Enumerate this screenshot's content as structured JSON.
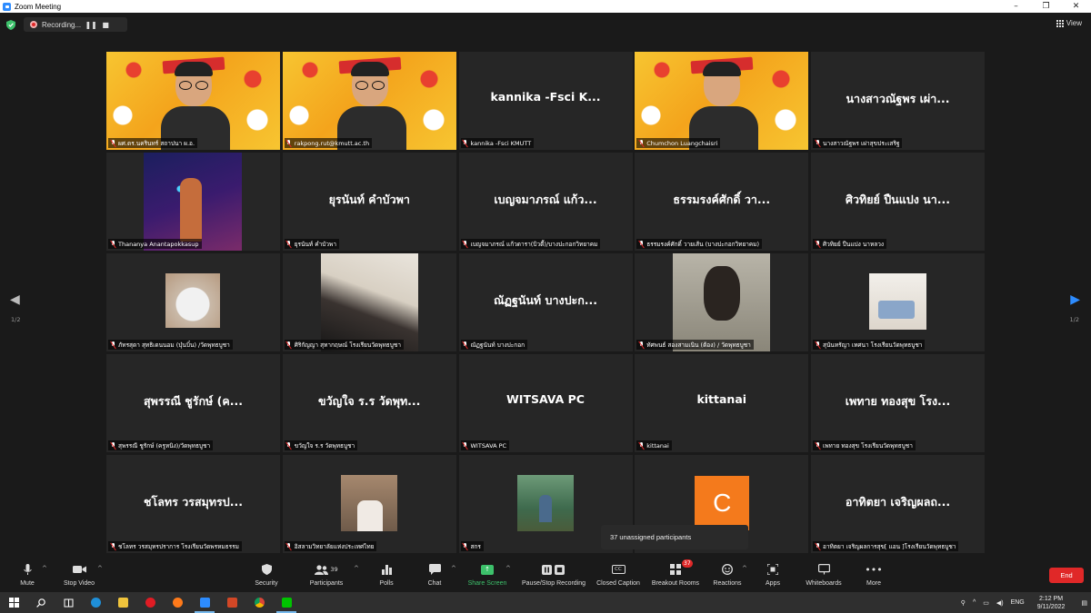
{
  "window": {
    "title": "Zoom Meeting",
    "controls": [
      "–",
      "❐",
      "✕"
    ]
  },
  "meeting_bar": {
    "recording_label": "Recording...",
    "view_label": "View"
  },
  "tiles": [
    {
      "type": "video",
      "label": "ผศ.ดร.นครินทร์ สถาปนา ผ.อ.",
      "active": false
    },
    {
      "type": "video",
      "label": "rakpong.rut@kmutt.ac.th",
      "active": false
    },
    {
      "type": "name",
      "display": "kannika -Fsci K...",
      "label": "kannika -Fsci KMUTT"
    },
    {
      "type": "video",
      "label": "Chumchon Luangchaisri",
      "active": true
    },
    {
      "type": "name",
      "display": "นางสาวณัฐพร เผ่า...",
      "label": "นางสาวณัฐพร เผ่าสุขประเสริฐ"
    },
    {
      "type": "image",
      "img": "th-neon",
      "label": "Thananya Anantapokkasup"
    },
    {
      "type": "name",
      "display": "ยุรนันท์ คำบัวพา",
      "label": "ยุรนันท์ คำบัวพา"
    },
    {
      "type": "name",
      "display": "เบญจมาภรณ์ แก้ว...",
      "label": "เบญจมาภรณ์ แก้วดารา(บิวตี้)/บางปะกอกวิทยาคม"
    },
    {
      "type": "name",
      "display": "ธรรมรงค์ศักดิ์  วา...",
      "label": "ธรรมรงค์ศักดิ์  วายเส้น (บางปะกอกวิทยาคม)"
    },
    {
      "type": "name",
      "display": "ศิวทิยย์ ปืนแปง นา...",
      "label": "ศิวทิยย์ ปืนแปง นาหลวง"
    },
    {
      "type": "image",
      "img": "th-cat",
      "label": "ภัทรสุดา สุทธิเดนนอม (บุ๋นบิ๋น) /วัดพุทธบูชา"
    },
    {
      "type": "image",
      "img": "th-hair",
      "label": "ศิริกัญญา สุทากฤษณ์ โรงเรียนวัดพุทธบูชา"
    },
    {
      "type": "name",
      "display": "ณัฏฐนันท์ บางปะก...",
      "label": "ณัฏฐนันท์ บางปะกอก"
    },
    {
      "type": "image",
      "img": "th-mask",
      "label": "ทัศพนธ์ สองสามเนิน (ต้อง) / วัดพุทธบูชา"
    },
    {
      "type": "image",
      "img": "th-room",
      "label": "สุนันทรัญา เทศนา โรงเรียนวัดพุทธบูชา"
    },
    {
      "type": "name",
      "display": "สุพรรณี ชูรักษ์ (ค...",
      "label": "สุพรรณี ชูรักษ์ (ครูหนิง)/วัดพุทธบูชา"
    },
    {
      "type": "name",
      "display": "ขวัญใจ ร.ร วัดพุท...",
      "label": "ขวัญใจ ร.ร วัดพุทธบูชา"
    },
    {
      "type": "name",
      "display": "WITSAVA PC",
      "label": "WITSAVA PC"
    },
    {
      "type": "name",
      "display": "kittanai",
      "label": "kittanai"
    },
    {
      "type": "name",
      "display": "เพทาย ทองสุข โรง...",
      "label": "เพทาย ทองสุข โรงเรียนวัดพุทธบูชา"
    },
    {
      "type": "name",
      "display": "ชโลทร วรสมุทรป...",
      "label": "ชโลทร วรสมุทรปราการ โรงเรียนวัดพรหมธรรม"
    },
    {
      "type": "image",
      "img": "th-guy",
      "label": "อิสลามวิทยาลัยแห่งประเทศไทย"
    },
    {
      "type": "image",
      "img": "th-forest",
      "label": "สกร"
    },
    {
      "type": "avatar",
      "letter": "C",
      "label": ""
    },
    {
      "type": "name",
      "display": "อาทิตยา เจริญผลถ...",
      "label": "อาทิตยา เจริญผลการสุข[ แอน ]โรงเรียนวัดพุทธบูชา"
    }
  ],
  "paging": {
    "left": "1/2",
    "right": "1/2"
  },
  "tooltip": {
    "text": "37 unassigned participants"
  },
  "toolbar": {
    "mute": "Mute",
    "stop_video": "Stop Video",
    "security": "Security",
    "participants": "Participants",
    "participants_count": "39",
    "polls": "Polls",
    "chat": "Chat",
    "share_screen": "Share Screen",
    "record": "Pause/Stop Recording",
    "cc_glyph": "CC",
    "closed_caption": "Closed Caption",
    "breakout": "Breakout Rooms",
    "breakout_badge": "37",
    "reactions": "Reactions",
    "apps": "Apps",
    "whiteboards": "Whiteboards",
    "more": "More",
    "end": "End"
  },
  "taskbar": {
    "apps": [
      "start",
      "search",
      "task-view",
      "edge",
      "file-explorer",
      "opera",
      "firefox",
      "zoom",
      "powerpoint",
      "chrome",
      "line"
    ],
    "tray": {
      "lang": "ENG",
      "time": "2:12 PM",
      "date": "9/11/2022"
    }
  },
  "colors": {
    "accent": "#2d8cff",
    "active_speaker": "#e8e25b",
    "end_red": "#e02828",
    "share_green": "#3dc16b",
    "avatar_orange": "#f47a1c"
  }
}
